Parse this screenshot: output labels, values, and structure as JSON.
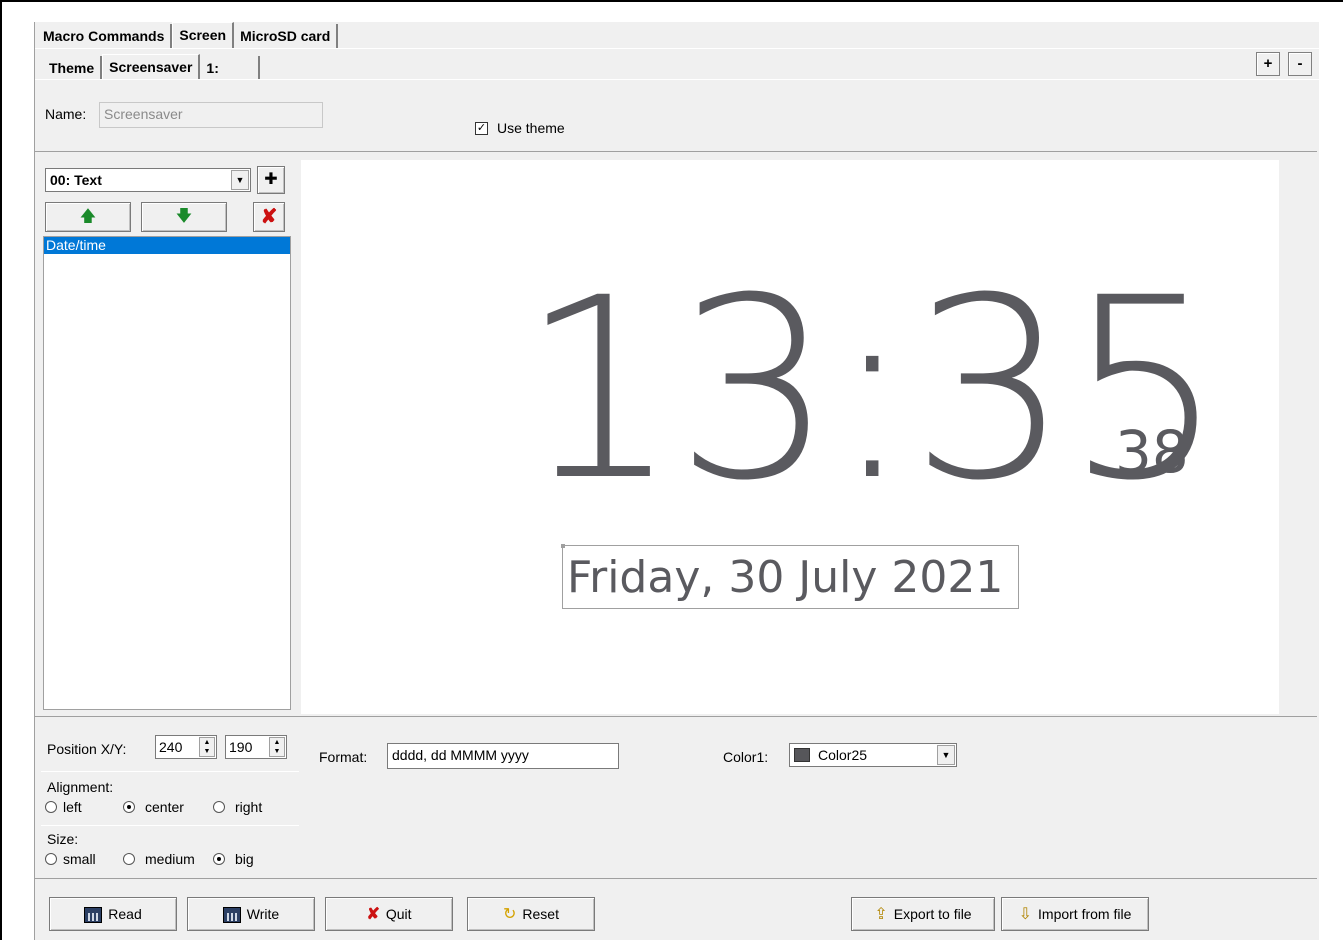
{
  "tabs_top": [
    {
      "label": "Macro Commands",
      "active": false
    },
    {
      "label": "Screen",
      "active": true
    },
    {
      "label": "MicroSD card",
      "active": false
    }
  ],
  "tabs_sub": [
    {
      "label": "Theme",
      "active": false
    },
    {
      "label": "Screensaver",
      "active": true
    },
    {
      "label": "1:",
      "active": false
    }
  ],
  "tab_controls": {
    "add": "+",
    "remove": "-"
  },
  "name_row": {
    "name_label": "Name:",
    "name_value": "Screensaver",
    "use_theme_label": "Use theme",
    "use_theme_checked": true
  },
  "elements": {
    "selected_type": "00: Text",
    "items": [
      {
        "label": "Date/time",
        "selected": true
      }
    ]
  },
  "preview": {
    "time": "13:35",
    "seconds": "38",
    "date": "Friday, 30 July 2021",
    "text_color": "#5a5a5f"
  },
  "props": {
    "position_label": "Position X/Y:",
    "x": "240",
    "y": "190",
    "format_label": "Format:",
    "format_value": "dddd, dd MMMM yyyy",
    "color_label": "Color1:",
    "color_value": "Color25",
    "color_swatch": "#56565a",
    "alignment_label": "Alignment:",
    "alignment_options": [
      "left",
      "center",
      "right"
    ],
    "alignment_selected": "center",
    "size_label": "Size:",
    "size_options": [
      "small",
      "medium",
      "big"
    ],
    "size_selected": "big"
  },
  "footer": {
    "read": "Read",
    "write": "Write",
    "quit": "Quit",
    "reset": "Reset",
    "export": "Export to file",
    "import": "Import from file"
  }
}
